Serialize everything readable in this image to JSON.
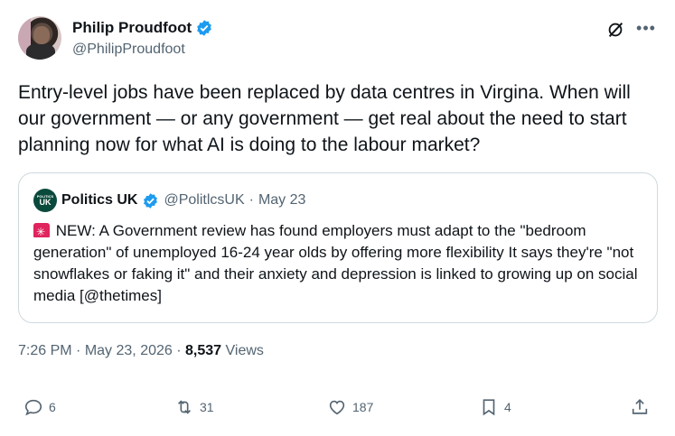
{
  "author": {
    "display_name": "Philip Proudfoot",
    "handle": "@PhilipProudfoot",
    "verified": true
  },
  "tweet": {
    "text": "Entry-level jobs have been replaced by data centres in Virgina. When will our government — or any government — get real about the need to start planning now for what AI is doing to the labour market?"
  },
  "quote": {
    "avatar_text": "POLITICS",
    "avatar_text2": "UK",
    "display_name": "Politics UK",
    "handle": "@PolitlcsUK",
    "separator": "·",
    "date": "May 23",
    "text": "NEW: A Government review has found employers must adapt to the \"bedroom generation\" of unemployed 16-24 year olds by offering more flexibility  It says they're \"not snowflakes or faking it\" and their anxiety and depression is linked to growing up on social media [@thetimes]",
    "siren_icon": "rotating-light-icon"
  },
  "meta": {
    "time": "7:26 PM",
    "sep1": "·",
    "date": "May 23, 2026",
    "sep2": "·",
    "views_count": "8,537",
    "views_label": "Views"
  },
  "actions": {
    "replies": "6",
    "reposts": "31",
    "likes": "187",
    "bookmarks": "4"
  },
  "colors": {
    "verified": "#1d9bf0",
    "muted": "#536471",
    "border": "#cfd9de"
  }
}
